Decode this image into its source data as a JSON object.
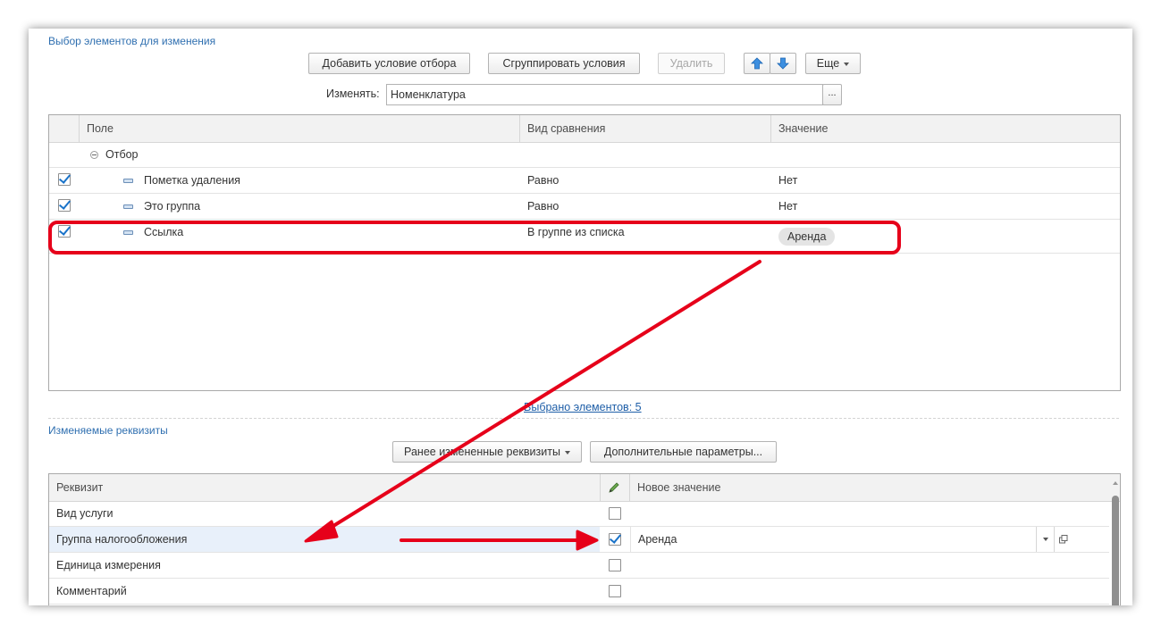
{
  "section1": {
    "title": "Выбор элементов для изменения",
    "toolbar": {
      "add_condition": "Добавить условие отбора",
      "group_conditions": "Сгруппировать условия",
      "delete": "Удалить",
      "more": "Еще"
    },
    "change_label": "Изменять:",
    "change_value": "Номенклатура",
    "change_select": "...",
    "filter_table": {
      "columns": [
        "Поле",
        "Вид сравнения",
        "Значение"
      ],
      "group_row": "Отбор",
      "rows": [
        {
          "checked": true,
          "field": "Пометка удаления",
          "comparison": "Равно",
          "value": "Нет"
        },
        {
          "checked": true,
          "field": "Это группа",
          "comparison": "Равно",
          "value": "Нет"
        },
        {
          "checked": true,
          "field": "Ссылка",
          "comparison": "В группе из списка",
          "value": "Аренда"
        }
      ]
    },
    "selected_link": "Выбрано элементов: 5"
  },
  "section2": {
    "title": "Изменяемые реквизиты",
    "toolbar": {
      "previous": "Ранее измененные реквизиты",
      "additional": "Дополнительные параметры..."
    },
    "table": {
      "columns": [
        "Реквизит",
        "Новое значение"
      ],
      "rows": [
        {
          "name": "Вид услуги",
          "checked": false,
          "value": ""
        },
        {
          "name": "Группа налогообложения",
          "checked": true,
          "value": "Аренда"
        },
        {
          "name": "Единица измерения",
          "checked": false,
          "value": ""
        },
        {
          "name": "Комментарий",
          "checked": false,
          "value": ""
        }
      ]
    }
  },
  "colors": {
    "accent": "#2f6fb0",
    "highlight": "#e6001a",
    "selected_row": "#e8f0fa"
  },
  "icons": [
    "arrow-up-icon",
    "arrow-down-icon",
    "pencil-icon",
    "dropdown-icon",
    "open-icon",
    "collapse-icon",
    "checkbox-icon"
  ]
}
